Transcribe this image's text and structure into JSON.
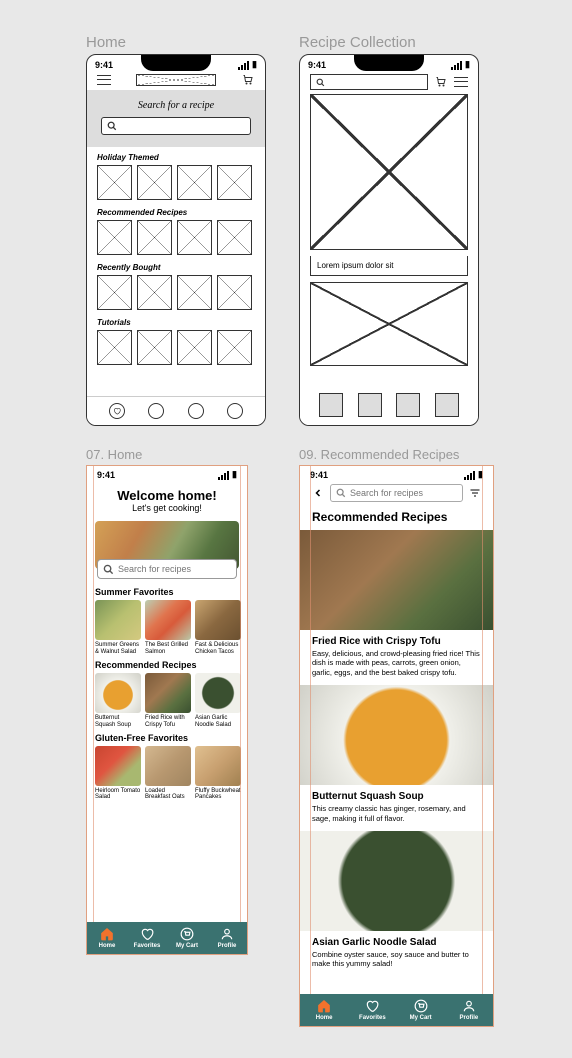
{
  "labels": {
    "w1": "Home",
    "w2": "Recipe Collection",
    "m1": "07. Home",
    "m2": "09. Recommended Recipes"
  },
  "status": {
    "time": "9:41"
  },
  "w1": {
    "hero_title": "Search for a recipe",
    "sections": [
      "Holiday Themed",
      "Recommended Recipes",
      "Recently Bought",
      "Tutorials"
    ]
  },
  "w2": {
    "caption": "Lorem ipsum dolor sit"
  },
  "m1": {
    "welcome_title": "Welcome home!",
    "welcome_sub": "Let's get cooking!",
    "search_placeholder": "Search for recipes",
    "sections": [
      {
        "title": "Summer Favorites",
        "items": [
          {
            "name": "Summer Greens & Walnut Salad",
            "img": "greens"
          },
          {
            "name": "The Best Grilled Salmon",
            "img": "salmon"
          },
          {
            "name": "Fast & Delicious Chicken Tacos",
            "img": "tacos"
          }
        ]
      },
      {
        "title": "Recommended Recipes",
        "items": [
          {
            "name": "Butternut Squash Soup",
            "img": "soup"
          },
          {
            "name": "Fried Rice with Crispy Tofu",
            "img": "rice"
          },
          {
            "name": "Asian Garlic Noodle Salad",
            "img": "noodle"
          }
        ]
      },
      {
        "title": "Gluten-Free Favorites",
        "items": [
          {
            "name": "Heirloom Tomato Salad",
            "img": "tomato"
          },
          {
            "name": "Loaded Breakfast Oats",
            "img": "oats"
          },
          {
            "name": "Fluffy Buckwheat Pancakes",
            "img": "pancake"
          }
        ]
      }
    ]
  },
  "m2": {
    "search_placeholder": "Search for recipes",
    "title": "Recommended Recipes",
    "cards": [
      {
        "name": "Fried Rice with Crispy Tofu",
        "desc": "Easy, delicious, and crowd-pleasing fried rice! This dish is made with peas, carrots, green onion, garlic, eggs, and the best baked crispy tofu.",
        "img": "rice"
      },
      {
        "name": "Butternut Squash Soup",
        "desc": "This creamy classic has ginger, rosemary, and sage, making it full of flavor.",
        "img": "soup"
      },
      {
        "name": "Asian Garlic Noodle Salad",
        "desc": "Combine oyster sauce, soy sauce and butter to make this yummy salad!",
        "img": "noodle"
      }
    ]
  },
  "tabs": [
    {
      "label": "Home",
      "icon": "home"
    },
    {
      "label": "Favorites",
      "icon": "heart"
    },
    {
      "label": "My Cart",
      "icon": "cart"
    },
    {
      "label": "Profile",
      "icon": "user"
    }
  ]
}
